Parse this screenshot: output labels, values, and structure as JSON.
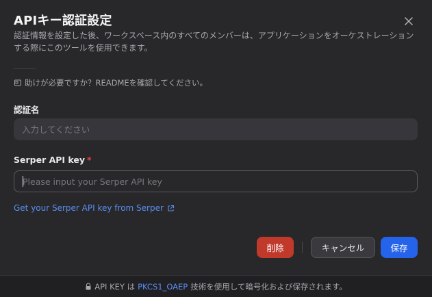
{
  "dialog": {
    "title": "APIキー認証設定",
    "subtitle": "認証情報を設定した後、ワークスペース内のすべてのメンバーは、アプリケーションをオーケストレーションする際にこのツールを使用できます。",
    "help_text": "助けが必要ですか？READMEを確認してください。"
  },
  "form": {
    "auth_name": {
      "label": "認証名",
      "value": "",
      "placeholder": "入力してください"
    },
    "api_key": {
      "label": "Serper API key",
      "required_mark": "*",
      "value": "",
      "placeholder": "Please input your Serper API key"
    },
    "get_key_link": "Get your Serper API key from Serper"
  },
  "actions": {
    "delete_label": "削除",
    "cancel_label": "キャンセル",
    "save_label": "保存"
  },
  "footer": {
    "prefix": "API KEY は",
    "highlight": "PKCS1_OAEP",
    "suffix": "技術を使用して暗号化および保存されます。"
  },
  "icons": {
    "close": "close-icon",
    "help": "book-icon",
    "external": "external-link-icon",
    "lock": "lock-icon"
  },
  "colors": {
    "background": "#28282b",
    "accent": "#2563eb",
    "danger": "#c0392b",
    "link": "#5b8def",
    "required": "#ef4444"
  }
}
